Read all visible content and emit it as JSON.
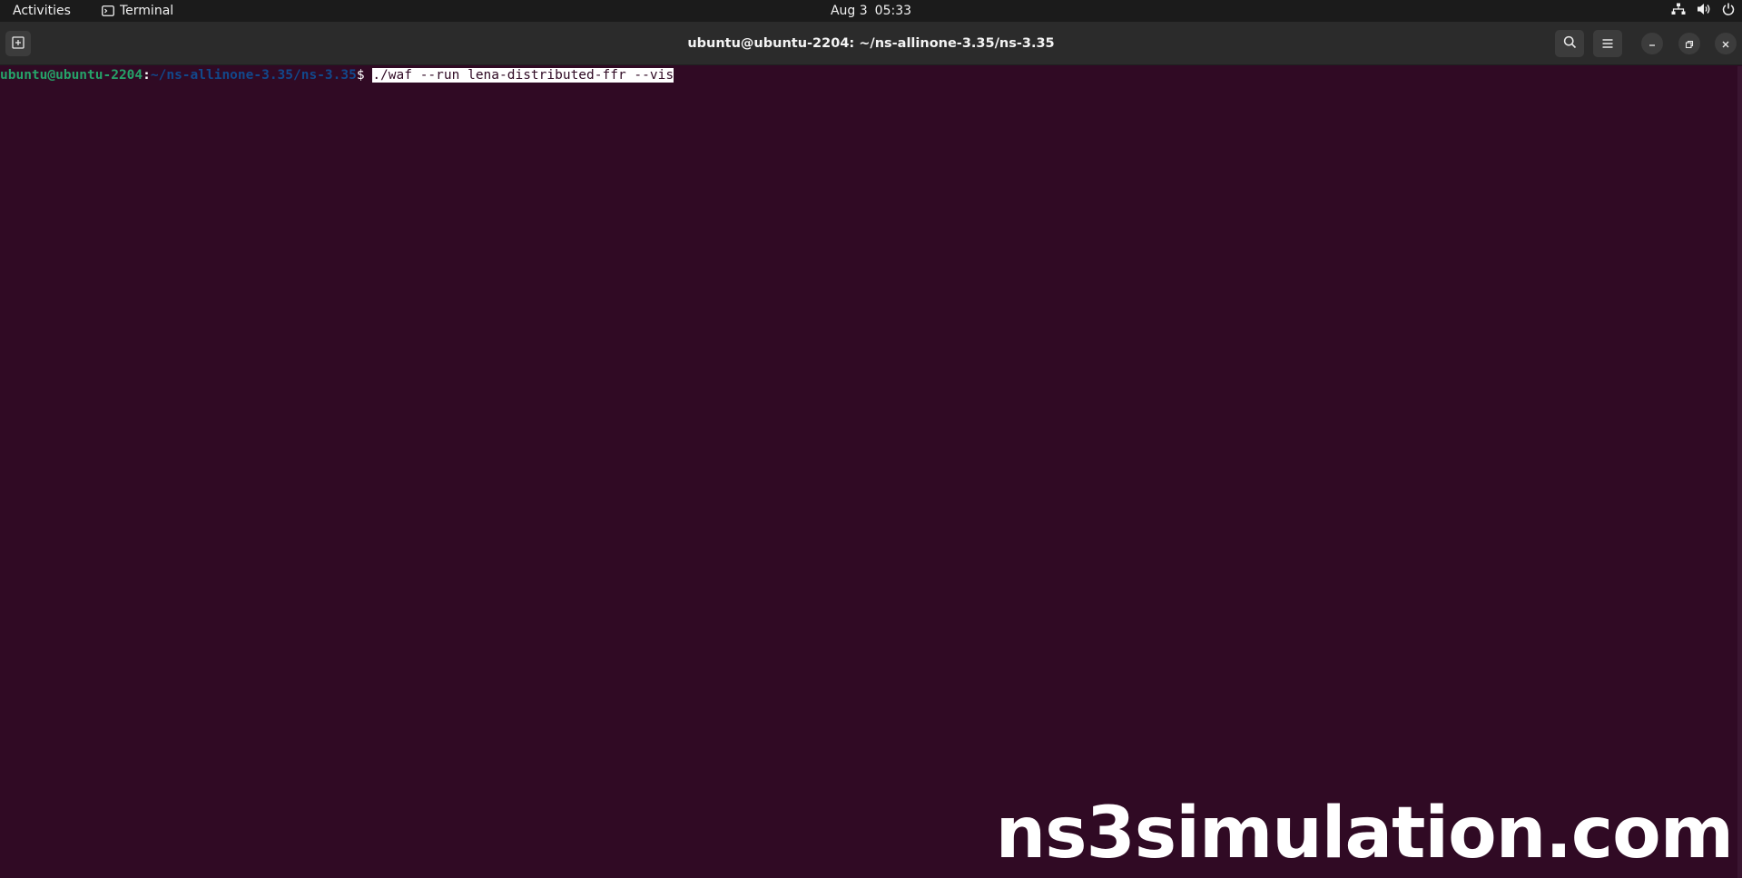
{
  "topbar": {
    "activities_label": "Activities",
    "app_name": "Terminal",
    "date": "Aug 3",
    "time": "05:33",
    "icons": [
      "network-icon",
      "volume-icon",
      "power-icon"
    ]
  },
  "window": {
    "title": "ubuntu@ubuntu-2204: ~/ns-allinone-3.35/ns-3.35",
    "buttons": [
      "new-tab-icon",
      "search-icon",
      "hamburger-menu-icon",
      "minimize-icon",
      "maximize-icon",
      "close-icon"
    ]
  },
  "terminal": {
    "prompt_user": "ubuntu@ubuntu-2204",
    "prompt_colon": ":",
    "prompt_path": "~/ns-allinone-3.35/ns-3.35",
    "prompt_dollar": "$ ",
    "command": "./waf --run lena-distributed-ffr --vis"
  },
  "watermark": {
    "text": "ns3simulation.com"
  },
  "colors": {
    "terminal_bg": "#300a24",
    "prompt_user": "#26a269",
    "prompt_path": "#12488b",
    "topbar_bg": "#1b1b1b",
    "headerbar_bg": "#2b2b2b"
  }
}
